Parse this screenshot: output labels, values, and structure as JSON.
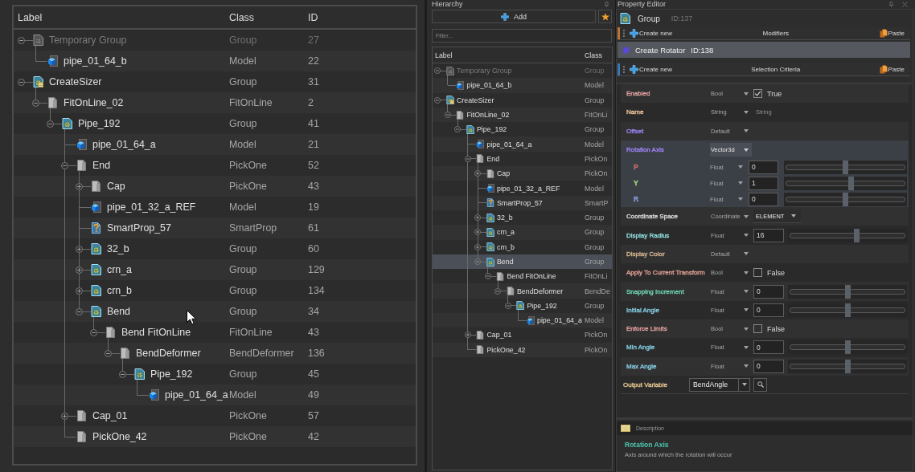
{
  "outline": {
    "columns": [
      "Label",
      "Class",
      "ID"
    ],
    "nodes": [
      {
        "label": "Temporary Group",
        "class": "Group",
        "id": "27",
        "kind": "group",
        "disabled": true,
        "selected": false,
        "expanded": true,
        "children": [
          {
            "label": "pipe_01_64_b",
            "class": "Model",
            "id": "22",
            "kind": "model",
            "disabled": false,
            "selected": false
          }
        ]
      },
      {
        "label": "CreateSizer",
        "class": "Group",
        "id": "31",
        "kind": "sizer",
        "disabled": false,
        "selected": false,
        "expanded": true,
        "children": [
          {
            "label": "FitOnLine_02",
            "class": "FitOnLine",
            "id": "2",
            "kind": "node",
            "disabled": false,
            "selected": false,
            "expanded": true,
            "children": [
              {
                "label": "Pipe_192",
                "class": "Group",
                "id": "41",
                "kind": "group",
                "disabled": false,
                "selected": false,
                "expanded": true,
                "children": [
                  {
                    "label": "pipe_01_64_a",
                    "class": "Model",
                    "id": "21",
                    "kind": "model",
                    "disabled": false,
                    "selected": false
                  },
                  {
                    "label": "End",
                    "class": "PickOne",
                    "id": "52",
                    "kind": "node",
                    "disabled": false,
                    "selected": false,
                    "expanded": true,
                    "children": [
                      {
                        "label": "Cap",
                        "class": "PickOne",
                        "id": "43",
                        "kind": "node",
                        "disabled": false,
                        "selected": false,
                        "expanded": false
                      },
                      {
                        "label": "pipe_01_32_a_REF",
                        "class": "Model",
                        "id": "19",
                        "kind": "model",
                        "disabled": false,
                        "selected": false
                      },
                      {
                        "label": "SmartProp_57",
                        "class": "SmartProp",
                        "id": "61",
                        "kind": "smartprop",
                        "disabled": false,
                        "selected": false
                      },
                      {
                        "label": "32_b",
                        "class": "Group",
                        "id": "60",
                        "kind": "group",
                        "disabled": false,
                        "selected": false,
                        "expanded": false
                      },
                      {
                        "label": "crn_a",
                        "class": "Group",
                        "id": "129",
                        "kind": "group",
                        "disabled": false,
                        "selected": false,
                        "expanded": false
                      },
                      {
                        "label": "crn_b",
                        "class": "Group",
                        "id": "134",
                        "kind": "group",
                        "disabled": false,
                        "selected": false,
                        "expanded": false
                      },
                      {
                        "label": "Bend",
                        "class": "Group",
                        "id": "34",
                        "kind": "group",
                        "disabled": false,
                        "selected": false,
                        "expanded": true,
                        "children": [
                          {
                            "label": "Bend FitOnLine",
                            "class": "FitOnLine",
                            "id": "43",
                            "kind": "node",
                            "disabled": false,
                            "selected": false,
                            "expanded": true,
                            "children": [
                              {
                                "label": "BendDeformer",
                                "class": "BendDeformer",
                                "id": "136",
                                "kind": "node",
                                "disabled": false,
                                "selected": false,
                                "expanded": true,
                                "children": [
                                  {
                                    "label": "Pipe_192",
                                    "class": "Group",
                                    "id": "45",
                                    "kind": "group",
                                    "disabled": false,
                                    "selected": false,
                                    "expanded": true,
                                    "children": [
                                      {
                                        "label": "pipe_01_64_a",
                                        "class": "Model",
                                        "id": "49",
                                        "kind": "model",
                                        "disabled": false,
                                        "selected": false
                                      }
                                    ]
                                  }
                                ]
                              }
                            ]
                          }
                        ]
                      }
                    ]
                  },
                  {
                    "label": "Cap_01",
                    "class": "PickOne",
                    "id": "57",
                    "kind": "node",
                    "disabled": false,
                    "selected": false,
                    "expanded": false
                  },
                  {
                    "label": "PickOne_42",
                    "class": "PickOne",
                    "id": "42",
                    "kind": "node",
                    "disabled": false,
                    "selected": false
                  }
                ]
              }
            ]
          }
        ]
      }
    ]
  },
  "hierarchy": {
    "title": "Hierarchy",
    "add_button": "Add",
    "filter": {
      "placeholder": "Filter..."
    },
    "columns": [
      "Label",
      "Class"
    ],
    "nodes": [
      {
        "label": "Temporary Group",
        "class": "Group",
        "kind": "group",
        "disabled": true,
        "selected": false,
        "expanded": true,
        "children": [
          {
            "label": "pipe_01_64_b",
            "class": "Model",
            "kind": "model",
            "disabled": false,
            "selected": false
          }
        ]
      },
      {
        "label": "CreateSizer",
        "class": "Group",
        "kind": "sizer",
        "disabled": false,
        "selected": false,
        "expanded": true,
        "children": [
          {
            "label": "FitOnLine_02",
            "class": "FitOnLi",
            "kind": "node",
            "disabled": false,
            "selected": false,
            "expanded": true,
            "children": [
              {
                "label": "Pipe_192",
                "class": "Group",
                "kind": "group",
                "disabled": false,
                "selected": false,
                "expanded": true,
                "children": [
                  {
                    "label": "pipe_01_64_a",
                    "class": "Model",
                    "kind": "model",
                    "disabled": false,
                    "selected": false
                  },
                  {
                    "label": "End",
                    "class": "PickOn",
                    "kind": "node",
                    "disabled": false,
                    "selected": false,
                    "expanded": true,
                    "children": [
                      {
                        "label": "Cap",
                        "class": "PickOn",
                        "kind": "node",
                        "disabled": false,
                        "selected": false,
                        "expanded": false
                      },
                      {
                        "label": "pipe_01_32_a_REF",
                        "class": "Model",
                        "kind": "model",
                        "disabled": false,
                        "selected": false
                      },
                      {
                        "label": "SmartProp_57",
                        "class": "SmartP",
                        "kind": "smartprop",
                        "disabled": false,
                        "selected": false
                      },
                      {
                        "label": "32_b",
                        "class": "Group",
                        "kind": "group",
                        "disabled": false,
                        "selected": false,
                        "expanded": false
                      },
                      {
                        "label": "crn_a",
                        "class": "Group",
                        "kind": "group",
                        "disabled": false,
                        "selected": false,
                        "expanded": false
                      },
                      {
                        "label": "crn_b",
                        "class": "Group",
                        "kind": "group",
                        "disabled": false,
                        "selected": false,
                        "expanded": false
                      },
                      {
                        "label": "Bend",
                        "class": "Group",
                        "kind": "group",
                        "disabled": false,
                        "selected": true,
                        "expanded": true,
                        "children": [
                          {
                            "label": "Bend FitOnLine",
                            "class": "FitOnLi",
                            "kind": "node",
                            "disabled": false,
                            "selected": false,
                            "expanded": true,
                            "children": [
                              {
                                "label": "BendDeformer",
                                "class": "BendDe",
                                "kind": "node",
                                "disabled": false,
                                "selected": false,
                                "expanded": true,
                                "children": [
                                  {
                                    "label": "Pipe_192",
                                    "class": "Group",
                                    "kind": "group",
                                    "disabled": false,
                                    "selected": false,
                                    "expanded": true,
                                    "children": [
                                      {
                                        "label": "pipe_01_64_a",
                                        "class": "Model",
                                        "kind": "model",
                                        "disabled": false,
                                        "selected": false
                                      }
                                    ]
                                  }
                                ]
                              }
                            ]
                          }
                        ]
                      }
                    ]
                  },
                  {
                    "label": "Cap_01",
                    "class": "PickOn",
                    "kind": "node",
                    "disabled": false,
                    "selected": false,
                    "expanded": false
                  },
                  {
                    "label": "PickOne_42",
                    "class": "PickOn",
                    "kind": "node",
                    "disabled": false,
                    "selected": false
                  }
                ]
              }
            ]
          }
        ]
      }
    ]
  },
  "property_editor": {
    "title": "Property Editor",
    "node": {
      "class": "Group",
      "id": "ID:137"
    },
    "sections": [
      {
        "create_button": "Create new",
        "title": "Modifiers",
        "paste_button": "Paste",
        "color": "#b8743a",
        "items": [
          {
            "name": "Create Rotator",
            "id": "ID:138",
            "selected": true
          }
        ]
      },
      {
        "create_button": "Create new",
        "title": "Selection Criteria",
        "paste_button": "Paste",
        "color": "#3a78b8"
      }
    ],
    "properties": [
      {
        "kind": "bool",
        "name": "Enabled",
        "color": "#e0a0a0",
        "type": "Bool",
        "checked": true,
        "value": "True",
        "selected": false
      },
      {
        "kind": "string",
        "name": "Name",
        "color": "#ecc49c",
        "type": "String",
        "placeholder": "String",
        "selected": false
      },
      {
        "kind": "default",
        "name": "Offset",
        "color": "#9d84f5",
        "type": "Default",
        "selected": false
      },
      {
        "kind": "vector",
        "name": "Rotation Axis",
        "color": "#9d84f5",
        "type": "Vector3d",
        "selected": true,
        "components": [
          {
            "name": "P",
            "color": "#c06a6a",
            "type": "Float",
            "value": "0",
            "level": 0.5
          },
          {
            "name": "Y",
            "color": "#9ccf7c",
            "type": "Float",
            "value": "1",
            "level": 0.55
          },
          {
            "name": "R",
            "color": "#8494cc",
            "type": "Float",
            "value": "0",
            "level": 0.5
          }
        ]
      },
      {
        "kind": "enum",
        "name": "Coordinate Space",
        "color": "#dcdcdc",
        "type": "Coordinate",
        "value": "ELEMENT",
        "selected": false
      },
      {
        "kind": "float",
        "name": "Display Radius",
        "color": "#92dede",
        "type": "Float",
        "value": "16",
        "level": 0.58,
        "selected": false
      },
      {
        "kind": "default",
        "name": "Display Color",
        "color": "#d8b890",
        "type": "Default",
        "selected": false
      },
      {
        "kind": "bool",
        "name": "Apply To Current Transform",
        "color": "#e4a096",
        "type": "Bool",
        "checked": false,
        "value": "False",
        "selected": false
      },
      {
        "kind": "float",
        "name": "Snapping Increment",
        "color": "#6ed4b4",
        "type": "Float",
        "value": "0",
        "level": 0.5,
        "selected": false
      },
      {
        "kind": "float",
        "name": "Initial Angle",
        "color": "#86cce2",
        "type": "Float",
        "value": "0",
        "level": 0.5,
        "selected": false
      },
      {
        "kind": "bool",
        "name": "Enforce Limits",
        "color": "#e4a0a0",
        "type": "Bool",
        "checked": false,
        "value": "False",
        "selected": false
      },
      {
        "kind": "float",
        "name": "Min Angle",
        "color": "#86cce2",
        "type": "Float",
        "value": "0",
        "level": 0.5,
        "selected": false
      },
      {
        "kind": "float",
        "name": "Max Angle",
        "color": "#86cce2",
        "type": "Float",
        "value": "0",
        "level": 0.5,
        "selected": false
      },
      {
        "kind": "output",
        "name": "Output Variable",
        "color": "#e2c490",
        "value": "BendAngle",
        "selected": false
      }
    ],
    "description": {
      "header": "Description",
      "title": "Rotation Axis",
      "text": "Axis around which the rotation will occur"
    }
  }
}
